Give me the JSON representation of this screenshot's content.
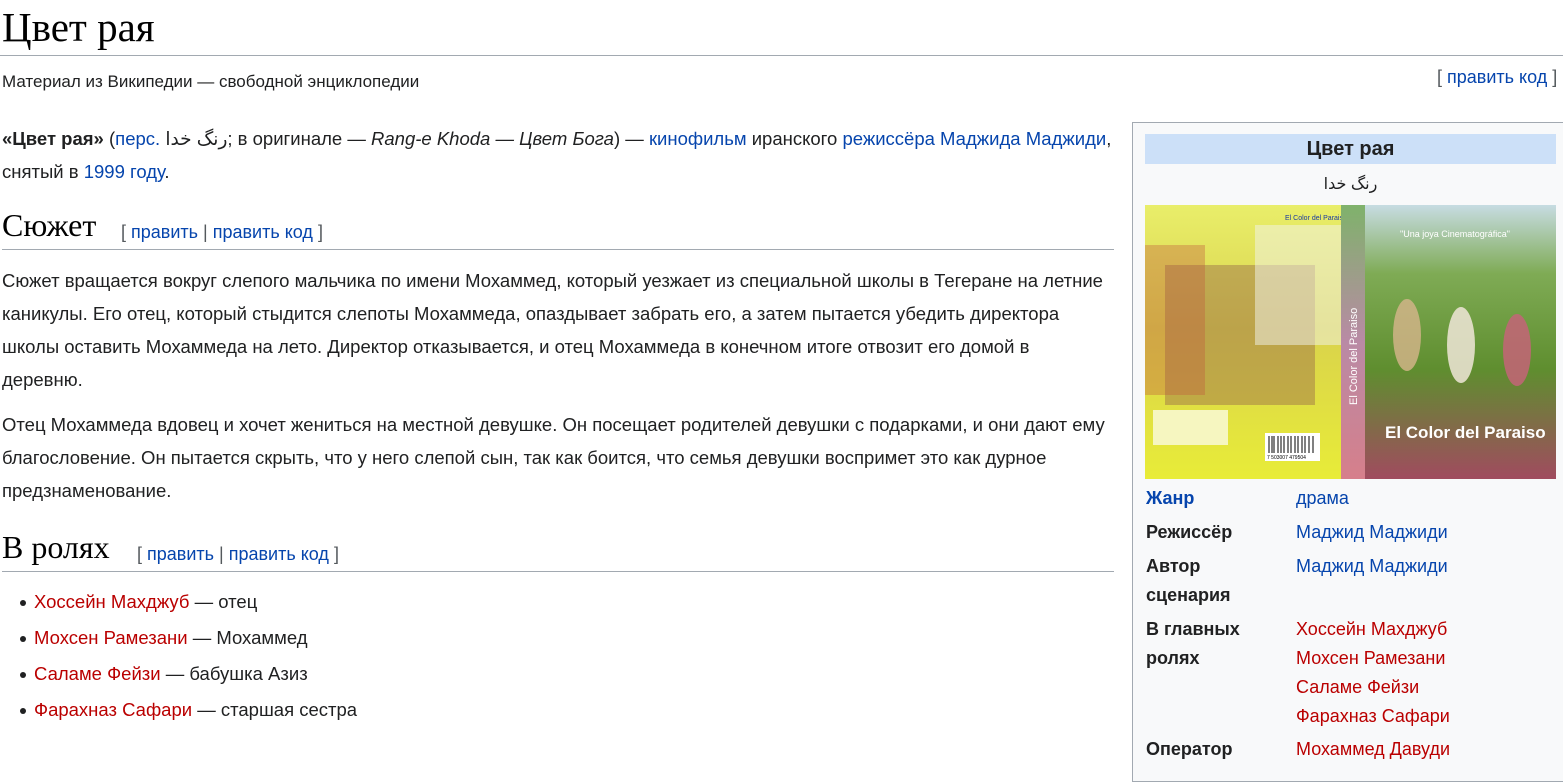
{
  "header": {
    "title": "Цвет рая",
    "tagline": "Материал из Википедии — свободной энциклопедии",
    "edit_code": "править код"
  },
  "intro": {
    "bold_title": "«Цвет рая»",
    "open_paren": " (",
    "pers_link": "перс.",
    "persian": "رنگ خدا",
    "orig_prefix": "; в оригинале — ",
    "orig_italic": "Rang-e Khoda — Цвет Бога",
    "close_paren_dash": ") — ",
    "film_link": "кинофильм",
    "iranian": " иранского ",
    "director_link": "режиссёра Маджида Маджиди",
    "shot_in": ", снятый в ",
    "year_link": "1999 году",
    "period": "."
  },
  "plot": {
    "heading": "Сюжет",
    "edit": "править",
    "edit_code": "править код",
    "paragraphs": [
      "Сюжет вращается вокруг слепого мальчика по имени Мохаммед, который уезжает из специальной школы в Тегеране на летние каникулы. Его отец, который стыдится слепоты Мохаммеда, опаздывает забрать его, а затем пытается убедить директора школы оставить Мохаммеда на лето. Директор отказывается, и отец Мохаммеда в конечном итоге отвозит его домой в деревню.",
      "Отец Мохаммеда вдовец и хочет жениться на местной девушке. Он посещает родителей девушки с подарками, и они дают ему благословение. Он пытается скрыть, что у него слепой сын, так как боится, что семья девушки воспримет это как дурное предзнаменование."
    ]
  },
  "cast": {
    "heading": "В ролях",
    "edit": "править",
    "edit_code": "править код",
    "items": [
      {
        "actor": "Хоссейн Махджуб",
        "role": " — отец"
      },
      {
        "actor": "Мохсен Рамезани",
        "role": " — Мохаммед"
      },
      {
        "actor": "Саламе Фейзи",
        "role": " — бабушка Азиз"
      },
      {
        "actor": "Фарахназ Сафари",
        "role": " — старшая сестра"
      }
    ]
  },
  "infobox": {
    "title": "Цвет рая",
    "original": "رنگ خدا",
    "poster": {
      "back_title": "El Color del Paraiso",
      "spine": "El Color del Paraiso",
      "front_title": "El Color del Paraiso",
      "quote": "\"Una joya Cinematográfica\"",
      "barcode": "7 503007 479504"
    },
    "genre_label": "Жанр",
    "genre": "драма",
    "director_label": "Режиссёр",
    "director": "Маджид Маджиди",
    "writer_label_1": "Автор",
    "writer_label_2": "сценария",
    "writer": "Маджид Маджиди",
    "starring_label_1": "В главных",
    "starring_label_2": "ролях",
    "starring": [
      "Хоссейн Махджуб",
      "Мохсен Рамезани",
      "Саламе Фейзи",
      "Фарахназ Сафари"
    ],
    "operator_label": "Оператор",
    "operator": "Мохаммед Давуди"
  },
  "colors": {
    "link": "#0645ad",
    "redlink": "#ba0000",
    "infobox_header": "#cce0f8",
    "infobox_bg": "#f8f9fa",
    "rule": "#a2a9b1"
  }
}
